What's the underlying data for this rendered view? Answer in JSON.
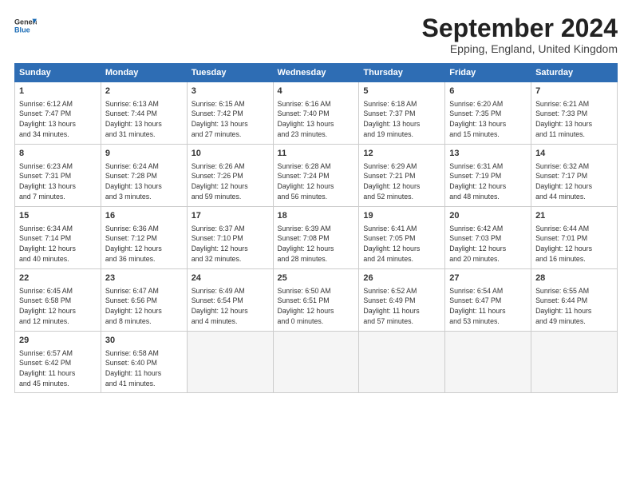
{
  "header": {
    "logo_line1": "General",
    "logo_line2": "Blue",
    "month_title": "September 2024",
    "location": "Epping, England, United Kingdom"
  },
  "weekdays": [
    "Sunday",
    "Monday",
    "Tuesday",
    "Wednesday",
    "Thursday",
    "Friday",
    "Saturday"
  ],
  "weeks": [
    [
      {
        "day": "1",
        "info": "Sunrise: 6:12 AM\nSunset: 7:47 PM\nDaylight: 13 hours\nand 34 minutes."
      },
      {
        "day": "2",
        "info": "Sunrise: 6:13 AM\nSunset: 7:44 PM\nDaylight: 13 hours\nand 31 minutes."
      },
      {
        "day": "3",
        "info": "Sunrise: 6:15 AM\nSunset: 7:42 PM\nDaylight: 13 hours\nand 27 minutes."
      },
      {
        "day": "4",
        "info": "Sunrise: 6:16 AM\nSunset: 7:40 PM\nDaylight: 13 hours\nand 23 minutes."
      },
      {
        "day": "5",
        "info": "Sunrise: 6:18 AM\nSunset: 7:37 PM\nDaylight: 13 hours\nand 19 minutes."
      },
      {
        "day": "6",
        "info": "Sunrise: 6:20 AM\nSunset: 7:35 PM\nDaylight: 13 hours\nand 15 minutes."
      },
      {
        "day": "7",
        "info": "Sunrise: 6:21 AM\nSunset: 7:33 PM\nDaylight: 13 hours\nand 11 minutes."
      }
    ],
    [
      {
        "day": "8",
        "info": "Sunrise: 6:23 AM\nSunset: 7:31 PM\nDaylight: 13 hours\nand 7 minutes."
      },
      {
        "day": "9",
        "info": "Sunrise: 6:24 AM\nSunset: 7:28 PM\nDaylight: 13 hours\nand 3 minutes."
      },
      {
        "day": "10",
        "info": "Sunrise: 6:26 AM\nSunset: 7:26 PM\nDaylight: 12 hours\nand 59 minutes."
      },
      {
        "day": "11",
        "info": "Sunrise: 6:28 AM\nSunset: 7:24 PM\nDaylight: 12 hours\nand 56 minutes."
      },
      {
        "day": "12",
        "info": "Sunrise: 6:29 AM\nSunset: 7:21 PM\nDaylight: 12 hours\nand 52 minutes."
      },
      {
        "day": "13",
        "info": "Sunrise: 6:31 AM\nSunset: 7:19 PM\nDaylight: 12 hours\nand 48 minutes."
      },
      {
        "day": "14",
        "info": "Sunrise: 6:32 AM\nSunset: 7:17 PM\nDaylight: 12 hours\nand 44 minutes."
      }
    ],
    [
      {
        "day": "15",
        "info": "Sunrise: 6:34 AM\nSunset: 7:14 PM\nDaylight: 12 hours\nand 40 minutes."
      },
      {
        "day": "16",
        "info": "Sunrise: 6:36 AM\nSunset: 7:12 PM\nDaylight: 12 hours\nand 36 minutes."
      },
      {
        "day": "17",
        "info": "Sunrise: 6:37 AM\nSunset: 7:10 PM\nDaylight: 12 hours\nand 32 minutes."
      },
      {
        "day": "18",
        "info": "Sunrise: 6:39 AM\nSunset: 7:08 PM\nDaylight: 12 hours\nand 28 minutes."
      },
      {
        "day": "19",
        "info": "Sunrise: 6:41 AM\nSunset: 7:05 PM\nDaylight: 12 hours\nand 24 minutes."
      },
      {
        "day": "20",
        "info": "Sunrise: 6:42 AM\nSunset: 7:03 PM\nDaylight: 12 hours\nand 20 minutes."
      },
      {
        "day": "21",
        "info": "Sunrise: 6:44 AM\nSunset: 7:01 PM\nDaylight: 12 hours\nand 16 minutes."
      }
    ],
    [
      {
        "day": "22",
        "info": "Sunrise: 6:45 AM\nSunset: 6:58 PM\nDaylight: 12 hours\nand 12 minutes."
      },
      {
        "day": "23",
        "info": "Sunrise: 6:47 AM\nSunset: 6:56 PM\nDaylight: 12 hours\nand 8 minutes."
      },
      {
        "day": "24",
        "info": "Sunrise: 6:49 AM\nSunset: 6:54 PM\nDaylight: 12 hours\nand 4 minutes."
      },
      {
        "day": "25",
        "info": "Sunrise: 6:50 AM\nSunset: 6:51 PM\nDaylight: 12 hours\nand 0 minutes."
      },
      {
        "day": "26",
        "info": "Sunrise: 6:52 AM\nSunset: 6:49 PM\nDaylight: 11 hours\nand 57 minutes."
      },
      {
        "day": "27",
        "info": "Sunrise: 6:54 AM\nSunset: 6:47 PM\nDaylight: 11 hours\nand 53 minutes."
      },
      {
        "day": "28",
        "info": "Sunrise: 6:55 AM\nSunset: 6:44 PM\nDaylight: 11 hours\nand 49 minutes."
      }
    ],
    [
      {
        "day": "29",
        "info": "Sunrise: 6:57 AM\nSunset: 6:42 PM\nDaylight: 11 hours\nand 45 minutes."
      },
      {
        "day": "30",
        "info": "Sunrise: 6:58 AM\nSunset: 6:40 PM\nDaylight: 11 hours\nand 41 minutes."
      },
      {
        "day": "",
        "info": ""
      },
      {
        "day": "",
        "info": ""
      },
      {
        "day": "",
        "info": ""
      },
      {
        "day": "",
        "info": ""
      },
      {
        "day": "",
        "info": ""
      }
    ]
  ]
}
